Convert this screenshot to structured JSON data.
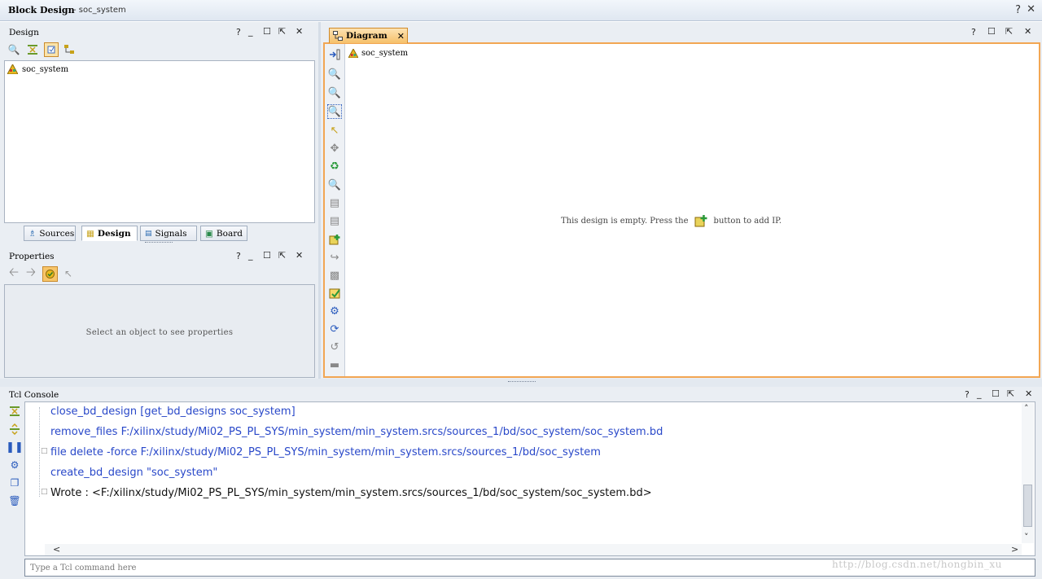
{
  "window": {
    "title": "Block Design",
    "subtitle": "- soc_system",
    "help": "?",
    "close": "✕"
  },
  "panel_controls": {
    "help": "?",
    "minimize": "_",
    "restore": "☐",
    "float": "⇱",
    "close": "✕"
  },
  "design_panel": {
    "title": "Design",
    "tree_item": "soc_system",
    "tabs": [
      "Sources",
      "Design",
      "Signals",
      "Board"
    ]
  },
  "properties_panel": {
    "title": "Properties",
    "placeholder": "Select an object to see properties"
  },
  "diagram_panel": {
    "tab_label": "Diagram",
    "tab_close": "✕",
    "breadcrumb": "soc_system",
    "empty_message_before": "This design is empty. Press the",
    "empty_message_after": "button to add IP."
  },
  "tcl_console": {
    "title": "Tcl Console",
    "lines": [
      "close_bd_design [get_bd_designs soc_system]",
      "remove_files  F:/xilinx/study/Mi02_PS_PL_SYS/min_system/min_system.srcs/sources_1/bd/soc_system/soc_system.bd",
      "file delete -force F:/xilinx/study/Mi02_PS_PL_SYS/min_system/min_system.srcs/sources_1/bd/soc_system",
      "create_bd_design \"soc_system\"",
      "Wrote  : <F:/xilinx/study/Mi02_PS_PL_SYS/min_system/min_system.srcs/sources_1/bd/soc_system/soc_system.bd>"
    ],
    "input_placeholder": "Type a Tcl command here",
    "scroll_left": "<",
    "scroll_right": ">",
    "scroll_up": "˄",
    "scroll_down": "˅"
  },
  "watermark": "http://blog.csdn.net/hongbin_xu",
  "colors": {
    "accent_orange": "#f2a653",
    "console_blue": "#2948c9",
    "panel_bg": "#eaeef3"
  }
}
